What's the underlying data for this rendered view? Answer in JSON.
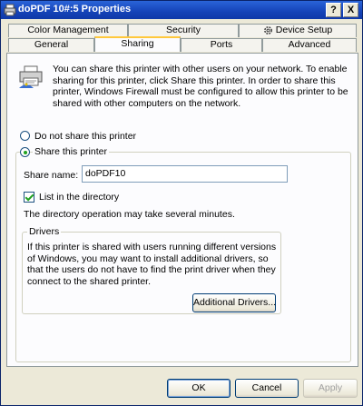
{
  "window": {
    "title": "doPDF 10#:5 Properties",
    "help_label": "?",
    "close_label": "X"
  },
  "tabs": {
    "row1": [
      {
        "label": "Color Management"
      },
      {
        "label": "Security"
      },
      {
        "label": "Device Setup",
        "icon": "gear-icon"
      }
    ],
    "row2": [
      {
        "label": "General"
      },
      {
        "label": "Sharing",
        "active": true
      },
      {
        "label": "Ports"
      },
      {
        "label": "Advanced"
      }
    ]
  },
  "sharing": {
    "intro_text": "You can share this printer with other users on your network. To enable sharing for this printer, click Share this printer. In order to share this printer, Windows Firewall must be configured to allow this printer to be shared with other computers on the network.",
    "do_not_share_label": "Do not share this printer",
    "share_label": "Share this printer",
    "share_selected": true,
    "share_name_label": "Share name:",
    "share_name_value": "doPDF10",
    "list_directory_label": "List in the directory",
    "list_directory_checked": true,
    "directory_note": "The directory operation may take several minutes.",
    "drivers_title": "Drivers",
    "drivers_text": "If this printer is shared with users running different versions of Windows, you may want to install additional drivers, so that the users do not have to find the print driver when they connect to the shared printer.",
    "additional_drivers_label": "Additional Drivers..."
  },
  "footer": {
    "ok_label": "OK",
    "cancel_label": "Cancel",
    "apply_label": "Apply"
  },
  "colors": {
    "titlebar": "#1543b8",
    "dialog_bg": "#ece9d8",
    "panel_bg": "#fcfcfe",
    "active_tab_accent": "#ffc83c",
    "check_green": "#21a121"
  }
}
